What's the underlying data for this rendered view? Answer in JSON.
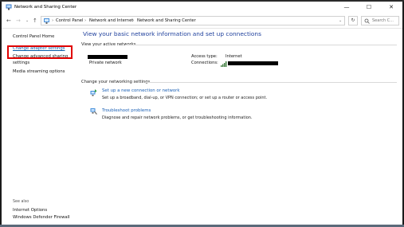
{
  "window": {
    "title": "Network and Sharing Center",
    "minimize": "—",
    "maximize": "☐",
    "close": "✕"
  },
  "address": {
    "back": "←",
    "forward": "→",
    "up": "↑",
    "crumbs": [
      "Control Panel",
      "Network and Internet",
      "Network and Sharing Center"
    ],
    "sep": "›",
    "dropdown": "⌄",
    "refresh": "↻",
    "search_placeholder": "Search C..."
  },
  "sidebar": {
    "home": "Control Panel Home",
    "change_adapter": "Change adapter settings",
    "change_advanced_line1": "Change advanced sharing",
    "change_advanced_line2": "settings",
    "media_streaming": "Media streaming options",
    "see_also": "See also",
    "internet_options": "Internet Options",
    "firewall": "Windows Defender Firewall"
  },
  "main": {
    "title": "View your basic network information and set up connections",
    "active_networks_label": "View your active networks",
    "network_type": "Private network",
    "access_type_label": "Access type:",
    "access_type_value": "Internet",
    "connections_label": "Connections:",
    "change_settings_label": "Change your networking settings",
    "tasks": [
      {
        "title": "Set up a new connection or network",
        "desc": "Set up a broadband, dial-up, or VPN connection; or set up a router or access point."
      },
      {
        "title": "Troubleshoot problems",
        "desc": "Diagnose and repair network problems, or get troubleshooting information."
      }
    ]
  },
  "colors": {
    "link": "#1a5fb4",
    "title": "#1e3f9c",
    "highlight": "#e00000"
  }
}
